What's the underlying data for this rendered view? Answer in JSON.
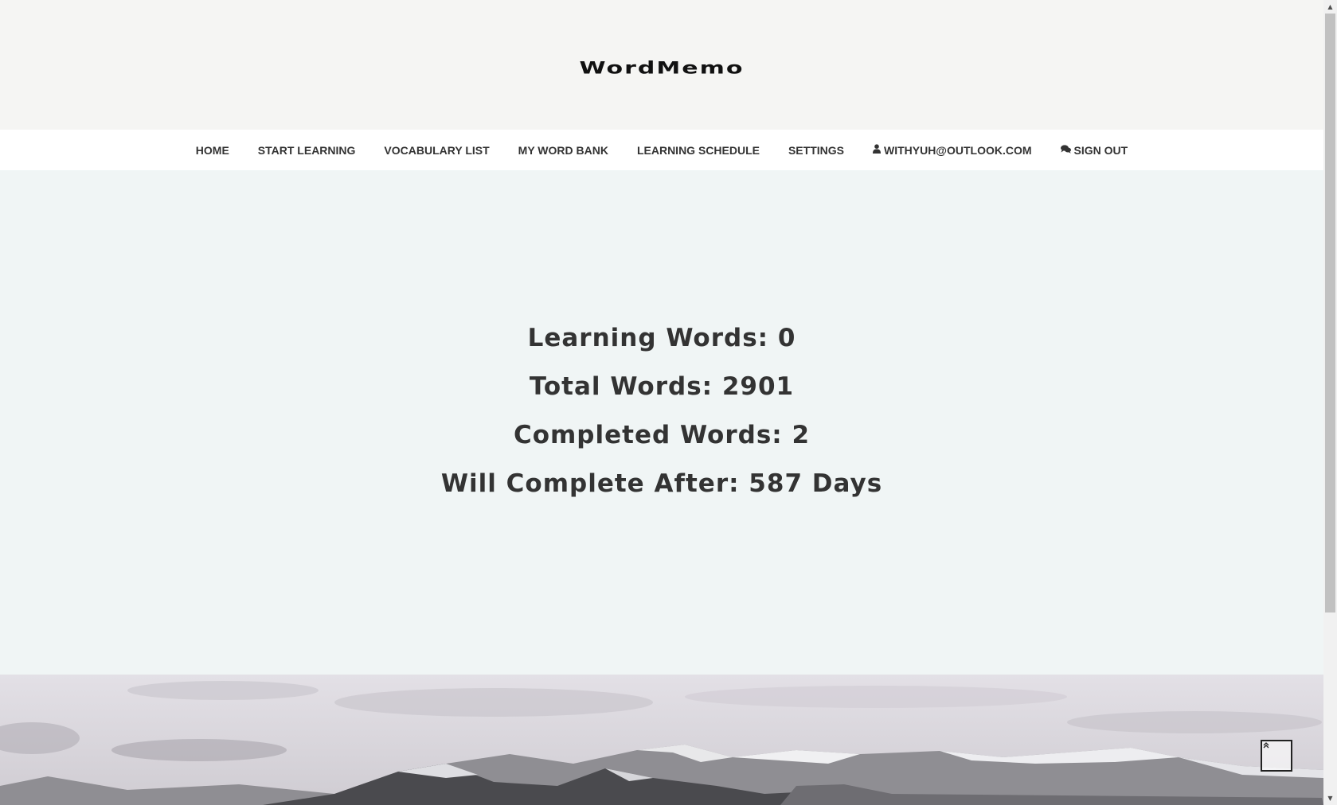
{
  "brand": {
    "logo_text": "WordMemo"
  },
  "nav": {
    "items": [
      {
        "label": "HOME"
      },
      {
        "label": "START LEARNING"
      },
      {
        "label": "VOCABULARY LIST"
      },
      {
        "label": "MY WORD BANK"
      },
      {
        "label": "LEARNING SCHEDULE"
      },
      {
        "label": "SETTINGS"
      },
      {
        "label": "WITHYUH@OUTLOOK.COM",
        "icon": "user-icon"
      },
      {
        "label": "SIGN OUT",
        "icon": "comments-icon"
      }
    ]
  },
  "stats": {
    "learning_words": "Learning Words: 0",
    "total_words": "Total Words: 2901",
    "completed_words": "Completed Words: 2",
    "will_complete": "Will Complete After: 587 Days"
  },
  "back_to_top": {
    "icon": "double-chevron-up-icon",
    "glyph": "»"
  },
  "colors": {
    "header_bg": "#f5f5f3",
    "nav_bg": "#ffffff",
    "stats_bg": "#f0f5f5",
    "text": "#333333"
  }
}
